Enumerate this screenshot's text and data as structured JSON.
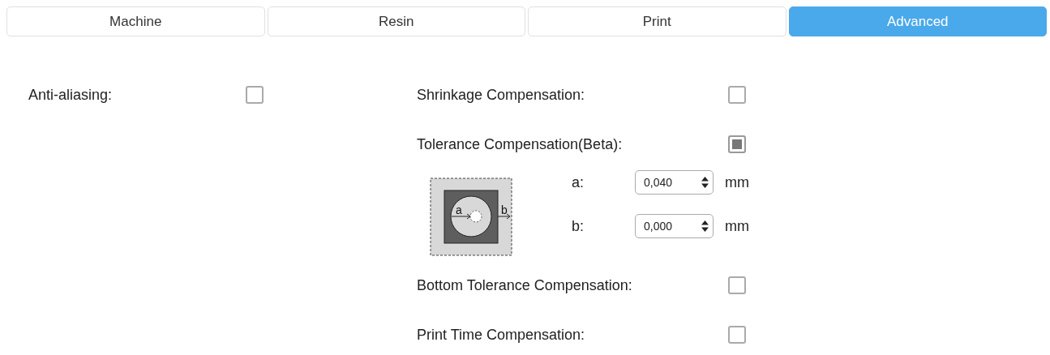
{
  "tabs": [
    {
      "label": "Machine",
      "selected": false
    },
    {
      "label": "Resin",
      "selected": false
    },
    {
      "label": "Print",
      "selected": false
    },
    {
      "label": "Advanced",
      "selected": true
    }
  ],
  "left_options": [
    {
      "kind": "checkbox",
      "label": "Anti-aliasing:",
      "checked": false
    }
  ],
  "right_options": [
    {
      "kind": "checkbox",
      "label": "Shrinkage Compensation:",
      "checked": false
    },
    {
      "kind": "checkbox",
      "label": "Tolerance Compensation(Beta):",
      "checked": true
    },
    {
      "kind": "params",
      "diagram_labels": [
        "a",
        "b"
      ],
      "fields": [
        {
          "label": "a:",
          "value": "0,040",
          "unit": "mm"
        },
        {
          "label": "b:",
          "value": "0,000",
          "unit": "mm"
        }
      ]
    },
    {
      "kind": "checkbox",
      "label": "Bottom Tolerance Compensation:",
      "checked": false
    },
    {
      "kind": "checkbox",
      "label": "Print Time Compensation:",
      "checked": false
    }
  ]
}
